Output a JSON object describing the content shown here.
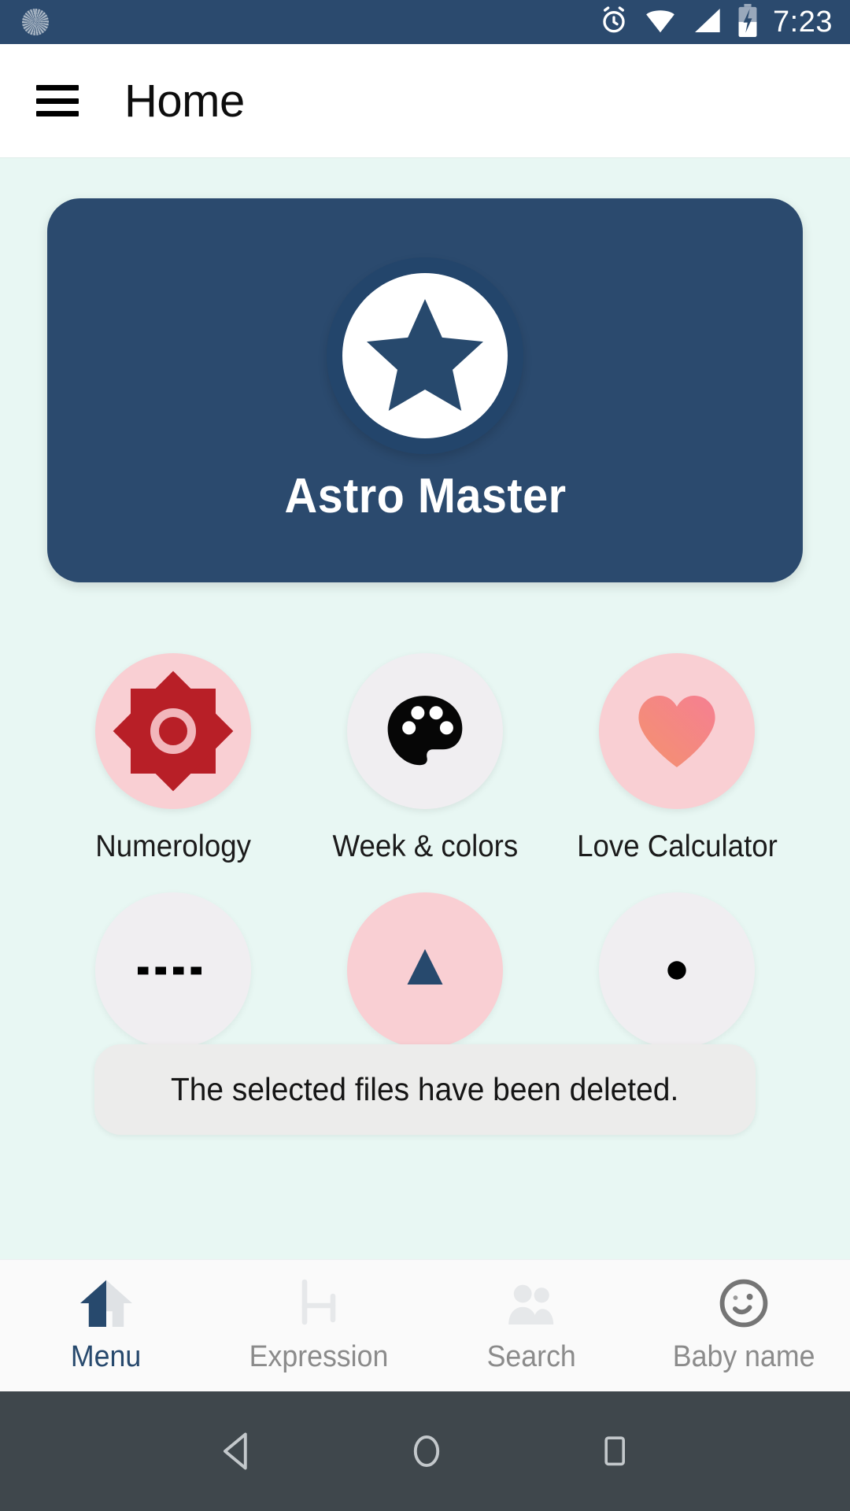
{
  "statusbar": {
    "time": "7:23",
    "icons": [
      "sync-icon",
      "alarm-icon",
      "wifi-icon",
      "signal-icon",
      "battery-charging-icon"
    ],
    "background": "#2b4a6e"
  },
  "appbar": {
    "menu_icon": "hamburger-menu-icon",
    "title": "Home",
    "background": "#ffffff"
  },
  "hero": {
    "app_name": "Astro Master",
    "logo_icon": "star-icon",
    "card_color": "#2b4a6e",
    "text_color": "#ffffff"
  },
  "content": {
    "background": "#e8f7f3"
  },
  "shortcuts": [
    {
      "label": "Numerology",
      "icon": "sun-star-icon",
      "circle_color": "#f9cfd3",
      "icon_color": "#b81f27"
    },
    {
      "label": "Week & colors",
      "icon": "palette-icon",
      "circle_color": "#f0eef1",
      "icon_color": "#000000"
    },
    {
      "label": "Love Calculator",
      "icon": "heart-icon",
      "circle_color": "#f9cfd3",
      "icon_color": "#f08080"
    }
  ],
  "shortcuts_row2": [
    {
      "label": "",
      "icon": "dots-icon",
      "circle_color": "#f0eef1",
      "icon_color": "#000000"
    },
    {
      "label": "",
      "icon": "triangle-icon",
      "circle_color": "#f9cfd3",
      "icon_color": "#27496d"
    },
    {
      "label": "",
      "icon": "dot-icon",
      "circle_color": "#f0eef1",
      "icon_color": "#000000"
    }
  ],
  "toast": {
    "message": "The selected files have been deleted.",
    "background": "#ececeb"
  },
  "bottomnav": {
    "active_color": "#27496d",
    "inactive_color": "#8b8b8b",
    "items": [
      {
        "label": "Menu",
        "icon": "home-icon",
        "active": true
      },
      {
        "label": "Expression",
        "icon": "chair-icon",
        "active": false
      },
      {
        "label": "Search",
        "icon": "people-icon",
        "active": false
      },
      {
        "label": "Baby name",
        "icon": "smiley-face-icon",
        "active": false
      }
    ]
  },
  "androidnav": {
    "background": "#3f474c",
    "buttons": [
      {
        "icon": "back-triangle-icon"
      },
      {
        "icon": "home-circle-icon"
      },
      {
        "icon": "recents-square-icon"
      }
    ]
  }
}
